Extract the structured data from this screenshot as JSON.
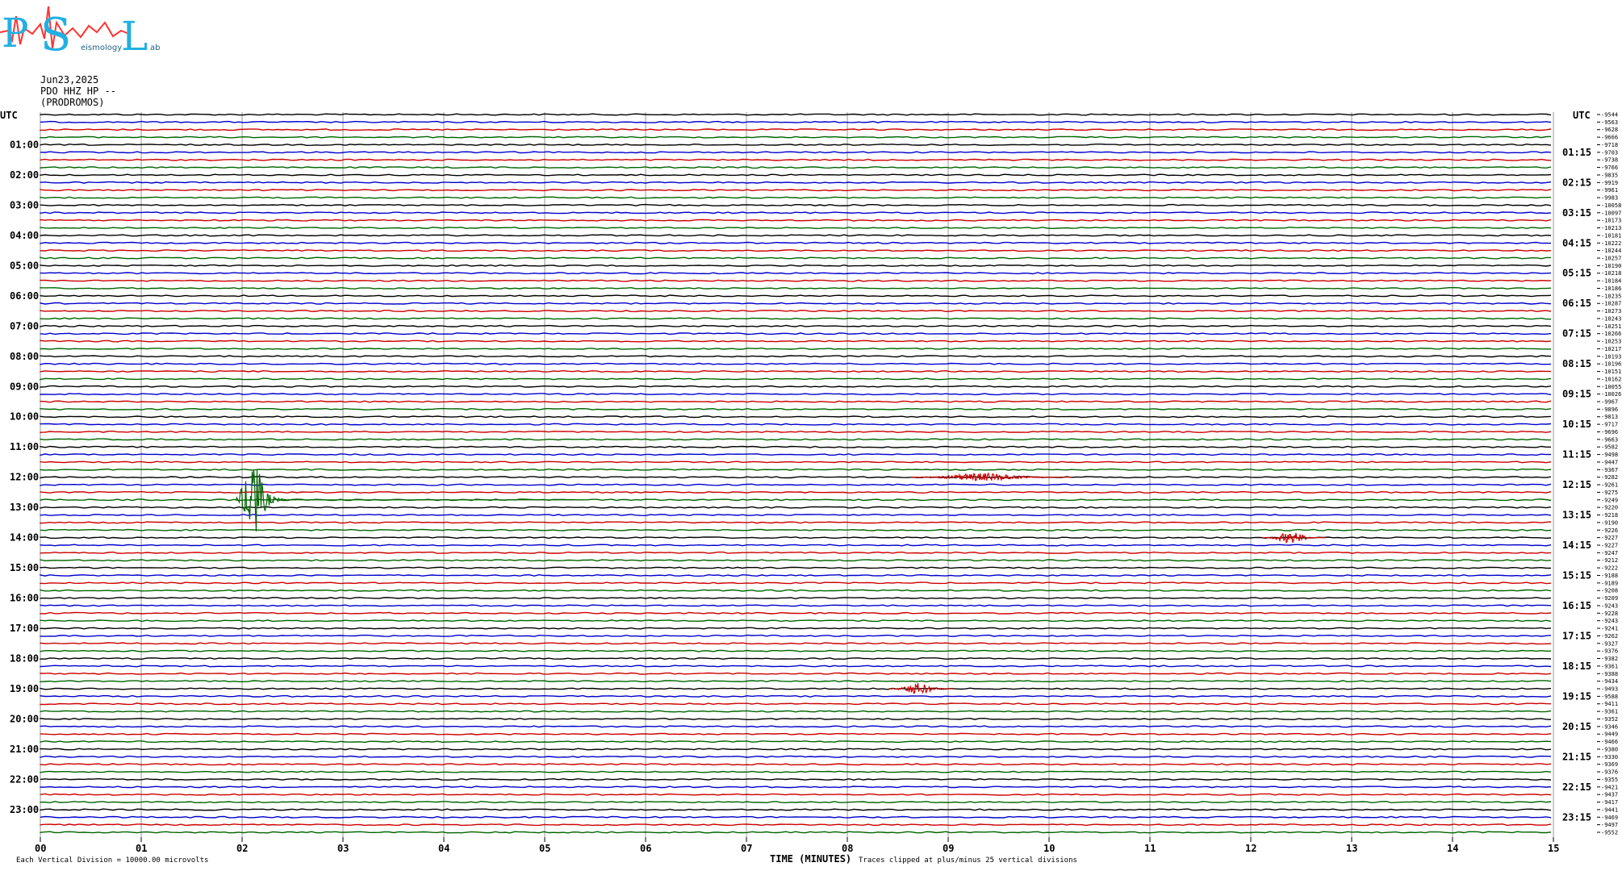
{
  "logo": {
    "letters": [
      "P",
      "S",
      "L"
    ],
    "tagline": "eismology",
    "tag_end": "ab"
  },
  "header": {
    "date": "Jun23,2025",
    "station": "PDO HHZ HP --",
    "site": "(PRODROMOS)"
  },
  "axis": {
    "left_title": "UTC",
    "right_title": "UTC",
    "x_title": "TIME (MINUTES)",
    "x_ticks": [
      "00",
      "01",
      "02",
      "03",
      "04",
      "05",
      "06",
      "07",
      "08",
      "09",
      "10",
      "11",
      "12",
      "13",
      "14",
      "15"
    ],
    "left_times": [
      "01:00",
      "02:00",
      "03:00",
      "04:00",
      "05:00",
      "06:00",
      "07:00",
      "08:00",
      "09:00",
      "10:00",
      "11:00",
      "12:00",
      "13:00",
      "14:00",
      "15:00",
      "16:00",
      "17:00",
      "18:00",
      "19:00",
      "20:00",
      "21:00",
      "22:00",
      "23:00"
    ],
    "right_times": [
      "01:15",
      "02:15",
      "03:15",
      "04:15",
      "05:15",
      "06:15",
      "07:15",
      "08:15",
      "09:15",
      "10:15",
      "11:15",
      "12:15",
      "13:15",
      "14:15",
      "15:15",
      "16:15",
      "17:15",
      "18:15",
      "19:15",
      "20:15",
      "21:15",
      "22:15",
      "23:15"
    ]
  },
  "footer": {
    "scale": "Each Vertical Division = 10000.00 microvolts",
    "clip": "Traces clipped at plus/minus 25 vertical divisions"
  },
  "colors": {
    "cycle": [
      "#000000",
      "#0000cc",
      "#cc0000",
      "#006400"
    ],
    "grid": "#b0b0b0"
  },
  "chart_data": {
    "type": "line",
    "title": "",
    "xlabel": "TIME (MINUTES)",
    "ylabel": "UTC",
    "xlim": [
      0,
      15
    ],
    "rows_per_hour": 4,
    "minutes_per_row": 15,
    "trace_offsets": [
      -9544,
      -9563,
      -9628,
      -9666,
      -9718,
      -9703,
      -9738,
      -9766,
      -9835,
      -9919,
      -9961,
      -9983,
      -10058,
      -10097,
      -10173,
      -10213,
      -10181,
      -10222,
      -10244,
      -10257,
      -10190,
      -10218,
      -10184,
      -10186,
      -10235,
      -10287,
      -10273,
      -10243,
      -10251,
      -10266,
      -10253,
      -10217,
      -10193,
      -10196,
      -10151,
      -10162,
      -10055,
      -10026,
      -9967,
      -9896,
      -9813,
      -9717,
      -9696,
      -9663,
      -9582,
      -9498,
      -9447,
      -9367,
      -9282,
      -9261,
      -9275,
      -9249,
      -9220,
      -9218,
      -9190,
      -9226,
      -9227,
      -9227,
      -9247,
      -9212,
      -9222,
      -9188,
      -9189,
      -9208,
      -9209,
      -9243,
      -9228,
      -9243,
      -9241,
      -9262,
      -9327,
      -9376,
      -9382,
      -9361,
      -9388,
      -9434,
      -9493,
      -9588,
      -9411,
      -9361,
      -9352,
      -9346,
      -9449,
      -9466,
      -9380,
      -9330,
      -9369,
      -9376,
      -9355,
      -9421,
      -9437,
      -9417,
      -9441,
      -9469,
      -9497,
      -9552
    ],
    "events": [
      {
        "utc": "12:45",
        "minute": 2.1,
        "amplitude": "large",
        "color": "green"
      },
      {
        "utc": "12:00",
        "minute": 9.35,
        "amplitude": "medium",
        "color": "red"
      },
      {
        "utc": "14:00",
        "minute": 12.4,
        "amplitude": "small",
        "color": "red"
      },
      {
        "utc": "19:00",
        "minute": 8.7,
        "amplitude": "small",
        "color": "red"
      }
    ]
  }
}
